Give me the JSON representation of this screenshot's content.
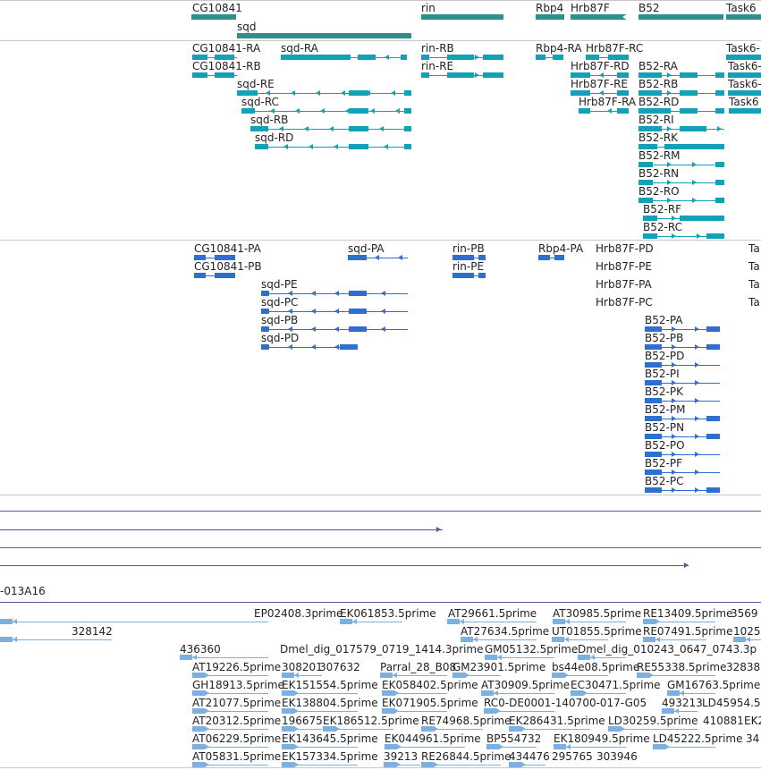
{
  "colors": {
    "gene": "#2f8f8a",
    "transcript": "#14a0b7",
    "protein": "#2f6fd0",
    "segment": "#6a4c9c",
    "est": "#7cb0e0"
  },
  "genes": [
    {
      "label": "CG10841"
    },
    {
      "label": "sqd"
    },
    {
      "label": "rin"
    },
    {
      "label": "Rbp4"
    },
    {
      "label": "Hrb87F"
    },
    {
      "label": "B52"
    },
    {
      "label": "Task6"
    }
  ],
  "transcripts": [
    {
      "label": "CG10841-RA"
    },
    {
      "label": "CG10841-RB"
    },
    {
      "label": "sqd-RA"
    },
    {
      "label": "sqd-RE"
    },
    {
      "label": "sqd-RC"
    },
    {
      "label": "sqd-RB"
    },
    {
      "label": "sqd-RD"
    },
    {
      "label": "rin-RB"
    },
    {
      "label": "rin-RE"
    },
    {
      "label": "Rbp4-RA"
    },
    {
      "label": "Hrb87F-RC"
    },
    {
      "label": "Hrb87F-RD"
    },
    {
      "label": "Hrb87F-RE"
    },
    {
      "label": "Hrb87F-RA"
    },
    {
      "label": "Task6-"
    },
    {
      "label": "Task6-"
    },
    {
      "label": "Task6-"
    },
    {
      "label": "Task6"
    },
    {
      "label": "B52-RA"
    },
    {
      "label": "B52-RB"
    },
    {
      "label": "B52-RD"
    },
    {
      "label": "B52-RI"
    },
    {
      "label": "B52-RK"
    },
    {
      "label": "B52-RM"
    },
    {
      "label": "B52-RN"
    },
    {
      "label": "B52-RO"
    },
    {
      "label": "B52-RF"
    },
    {
      "label": "B52-RC"
    }
  ],
  "proteins": [
    {
      "label": "CG10841-PA"
    },
    {
      "label": "CG10841-PB"
    },
    {
      "label": "sqd-PA"
    },
    {
      "label": "sqd-PE"
    },
    {
      "label": "sqd-PC"
    },
    {
      "label": "sqd-PB"
    },
    {
      "label": "sqd-PD"
    },
    {
      "label": "rin-PB"
    },
    {
      "label": "rin-PE"
    },
    {
      "label": "Rbp4-PA"
    },
    {
      "label": "Hrb87F-PD"
    },
    {
      "label": "Hrb87F-PE"
    },
    {
      "label": "Hrb87F-PA"
    },
    {
      "label": "Hrb87F-PC"
    },
    {
      "label": "Ta"
    },
    {
      "label": "Ta"
    },
    {
      "label": "Ta"
    },
    {
      "label": "Ta"
    },
    {
      "label": "B52-PA"
    },
    {
      "label": "B52-PB"
    },
    {
      "label": "B52-PD"
    },
    {
      "label": "B52-PI"
    },
    {
      "label": "B52-PK"
    },
    {
      "label": "B52-PM"
    },
    {
      "label": "B52-PN"
    },
    {
      "label": "B52-PO"
    },
    {
      "label": "B52-PF"
    },
    {
      "label": "B52-PC"
    }
  ],
  "segments": [
    {
      "label": ""
    },
    {
      "label": ""
    },
    {
      "label": ""
    },
    {
      "label": ""
    },
    {
      "label": "-013A16"
    },
    {
      "label": ""
    }
  ],
  "ests": [
    {
      "label": "EP02408.3prime"
    },
    {
      "label": "EK061853.5prime"
    },
    {
      "label": "AT29661.5prime"
    },
    {
      "label": "AT30985.5prime"
    },
    {
      "label": "RE13409.5prime"
    },
    {
      "label": "3569"
    },
    {
      "label": "328142"
    },
    {
      "label": "AT27634.5prime"
    },
    {
      "label": "UT01855.5prime"
    },
    {
      "label": "RE07491.5prime"
    },
    {
      "label": "1025"
    },
    {
      "label": "436360"
    },
    {
      "label": "Dmel_dig_017579_0719_1414.3prime"
    },
    {
      "label": "GM05132.5prime"
    },
    {
      "label": "Dmel_dig_010243_0647_0743.3p"
    },
    {
      "label": "AT19226.5prime"
    },
    {
      "label": "308201"
    },
    {
      "label": "307632"
    },
    {
      "label": "Parral_28_B08"
    },
    {
      "label": "GM23901.5prime"
    },
    {
      "label": "bs44e08.5prime"
    },
    {
      "label": "RE55338.5prime"
    },
    {
      "label": "32838"
    },
    {
      "label": "GH18913.5prime"
    },
    {
      "label": "EK151554.5prime"
    },
    {
      "label": "EK058402.5prime"
    },
    {
      "label": "AT30909.5prime"
    },
    {
      "label": "EC30471.5prime"
    },
    {
      "label": "GM16763.5prime"
    },
    {
      "label": "AT21077.5prime"
    },
    {
      "label": "EK138804.5prime"
    },
    {
      "label": "EK071905.5prime"
    },
    {
      "label": "RC0-DE0001-140700-017-G05"
    },
    {
      "label": "493213"
    },
    {
      "label": "LD45954.5"
    },
    {
      "label": "AT20312.5prime"
    },
    {
      "label": "196675"
    },
    {
      "label": "EK186512.5prime"
    },
    {
      "label": "RE74968.5prime"
    },
    {
      "label": "EK286431.5prime"
    },
    {
      "label": "LD30259.5prime"
    },
    {
      "label": "410881"
    },
    {
      "label": "EK2"
    },
    {
      "label": "AT06229.5prime"
    },
    {
      "label": "EK143645.5prime"
    },
    {
      "label": "EK044961.5prime"
    },
    {
      "label": "BP554732"
    },
    {
      "label": "EK180949.5prime"
    },
    {
      "label": "LD45222.5prime"
    },
    {
      "label": "34"
    },
    {
      "label": "AT05831.5prime"
    },
    {
      "label": "EK157334.5prime"
    },
    {
      "label": "39213"
    },
    {
      "label": "RE26844.5prime"
    },
    {
      "label": "434476"
    },
    {
      "label": "295765"
    },
    {
      "label": "303946"
    }
  ]
}
